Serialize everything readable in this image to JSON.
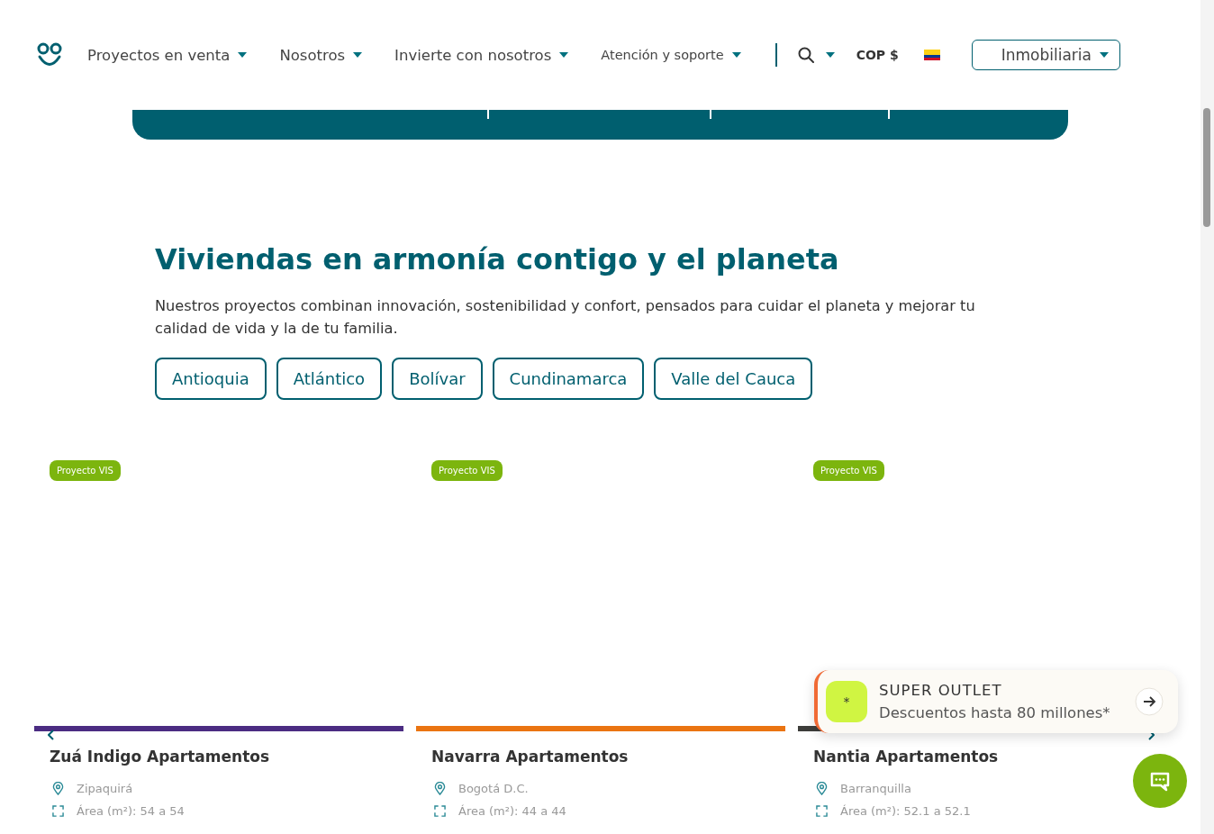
{
  "header": {
    "nav": [
      {
        "label": "Proyectos en venta"
      },
      {
        "label": "Nosotros"
      },
      {
        "label": "Invierte con nosotros"
      },
      {
        "label": "Atención y soporte"
      }
    ],
    "currency": "COP $",
    "account_menu": "Inmobiliaria"
  },
  "section": {
    "title": "Viviendas en armonía contigo y el planeta",
    "description": "Nuestros proyectos combinan innovación, sostenibilidad y confort, pensados para cuidar el planeta y mejorar tu calidad de vida y la de tu familia.",
    "regions": [
      "Antioquia",
      "Atlántico",
      "Bolívar",
      "Cundinamarca",
      "Valle del Cauca"
    ]
  },
  "projects": [
    {
      "badge": "Proyecto VIS",
      "name": "Zuá Indigo Apartamentos",
      "location": "Zipaquirá",
      "area": "Área (m²): 54 a 54",
      "color": "#4b2c82"
    },
    {
      "badge": "Proyecto VIS",
      "name": "Navarra Apartamentos",
      "location": "Bogotá D.C.",
      "area": "Área (m²): 44 a 44",
      "color": "#ea7411"
    },
    {
      "badge": "Proyecto VIS",
      "name": "Nantia Apartamentos",
      "location": "Barranquilla",
      "area": "Área (m²): 52.1 a 52.1",
      "color": "#3d3d3a"
    }
  ],
  "promo": {
    "mark": "*",
    "title": "SUPER OUTLET",
    "subtitle": "Descuentos hasta 80 millones*"
  }
}
